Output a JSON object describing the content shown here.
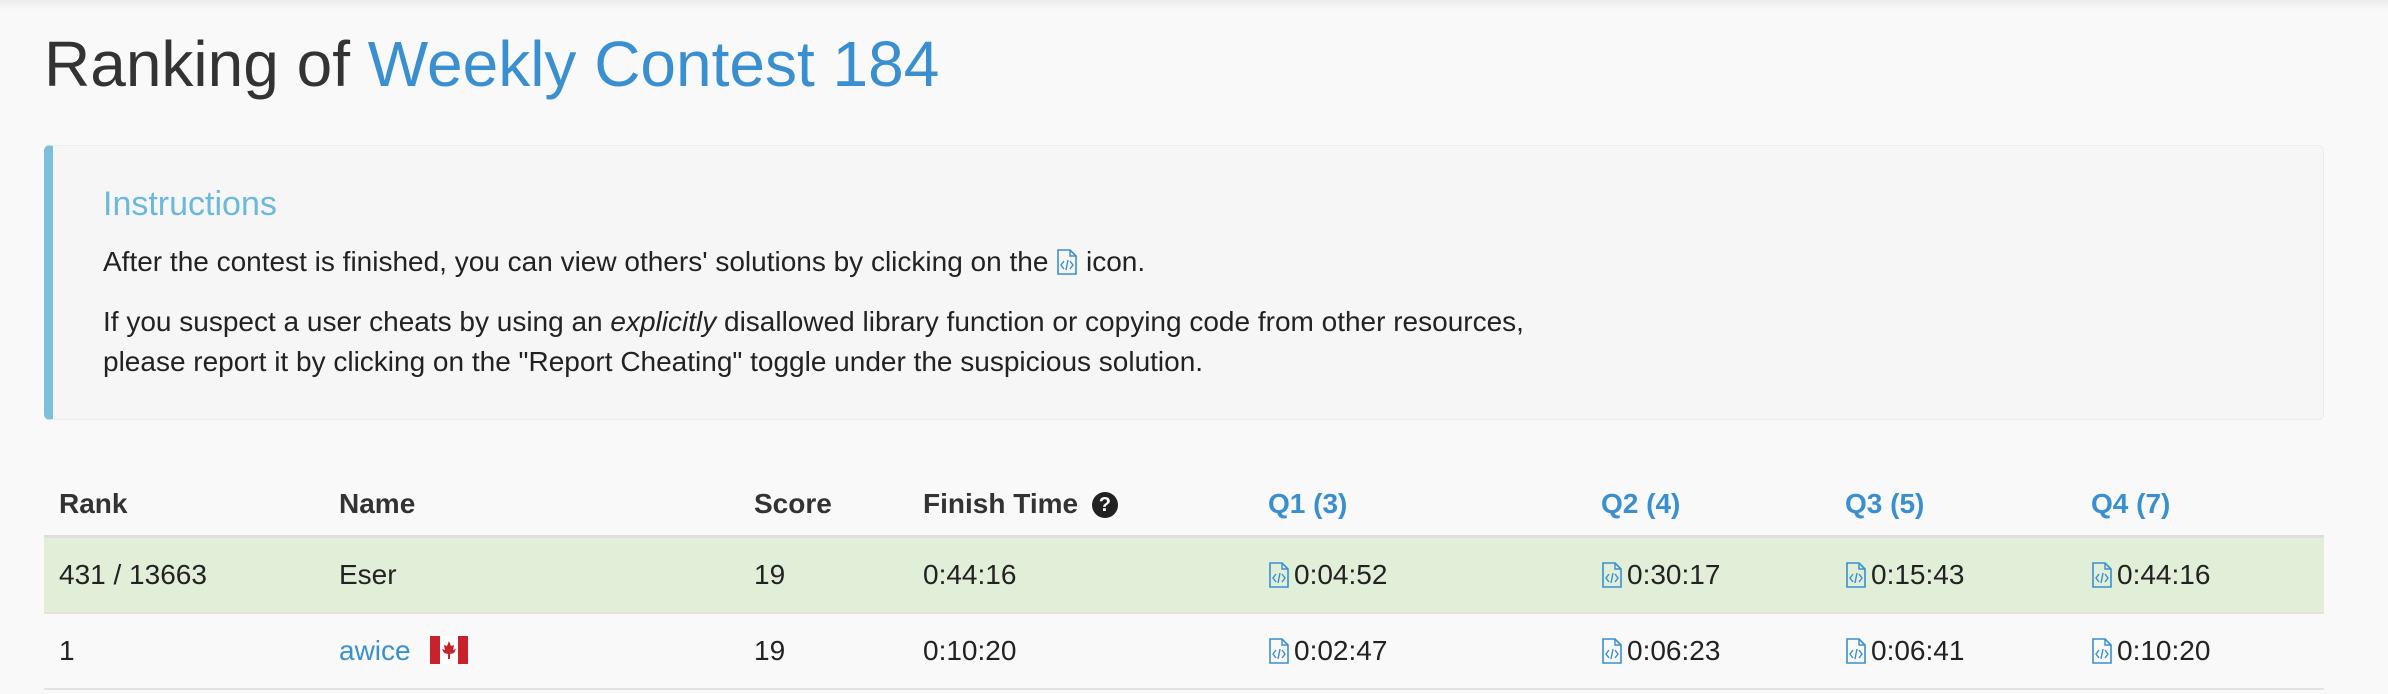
{
  "page": {
    "title_prefix": "Ranking of",
    "contest_name": "Weekly Contest 184"
  },
  "instructions": {
    "heading": "Instructions",
    "line1_before": "After the contest is finished, you can view others' solutions by clicking on the",
    "line1_after": "icon.",
    "line2_before": "If you suspect a user cheats by using an",
    "line2_emphasis": "explicitly",
    "line2_after": "disallowed library function or copying code from other resources,",
    "line3": "please report it by clicking on the \"Report Cheating\" toggle under the suspicious solution."
  },
  "table": {
    "headers": {
      "rank": "Rank",
      "name": "Name",
      "score": "Score",
      "finish_time": "Finish Time",
      "help_icon": "?",
      "q1": "Q1 (3)",
      "q2": "Q2 (4)",
      "q3": "Q3 (5)",
      "q4": "Q4 (7)"
    },
    "rows": [
      {
        "rank": "431 / 13663",
        "name": "Eser",
        "score": "19",
        "finish_time": "0:44:16",
        "q1": "0:04:52",
        "q2": "0:30:17",
        "q3": "0:15:43",
        "q4": "0:44:16",
        "highlight": true
      },
      {
        "rank": "1",
        "name": "awice",
        "flag": "canada-flag-icon",
        "score": "19",
        "finish_time": "0:10:20",
        "q1": "0:02:47",
        "q2": "0:06:23",
        "q3": "0:06:41",
        "q4": "0:10:20",
        "highlight": false
      }
    ]
  },
  "colors": {
    "link": "#3a8fd0",
    "panel_accent": "#7bbfdc",
    "highlight_row": "#e1efd9"
  }
}
